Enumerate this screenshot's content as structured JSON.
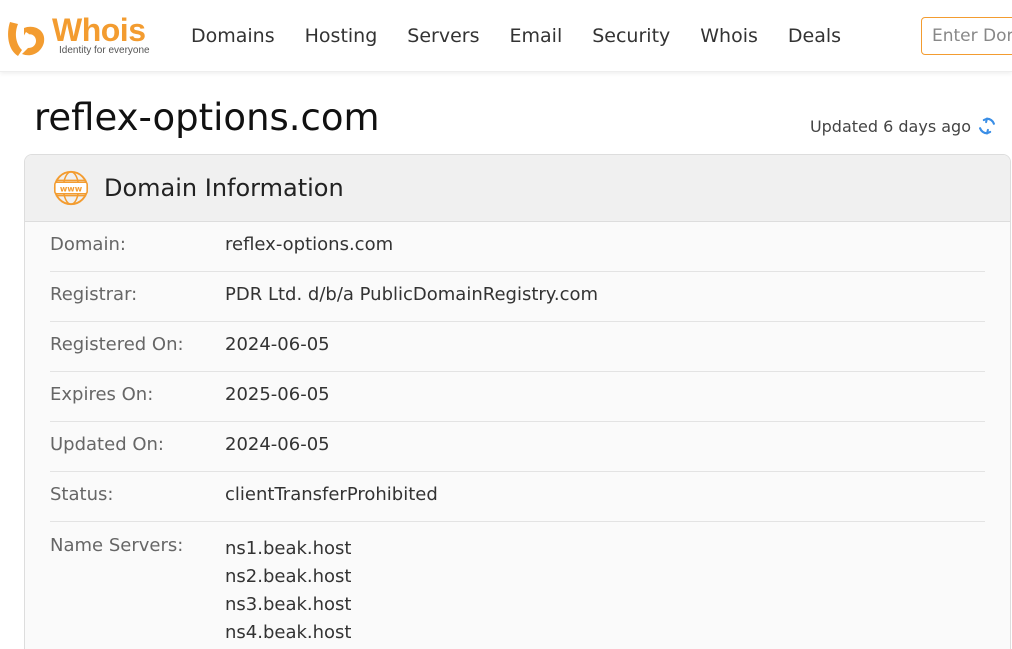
{
  "header": {
    "logo_word": "Whois",
    "logo_tagline": "Identity for everyone",
    "nav": [
      "Domains",
      "Hosting",
      "Servers",
      "Email",
      "Security",
      "Whois",
      "Deals"
    ],
    "search_placeholder": "Enter Domain"
  },
  "page": {
    "title": "reflex-options.com",
    "updated_text": "Updated 6 days ago"
  },
  "card": {
    "title": "Domain Information",
    "rows": [
      {
        "label": "Domain:",
        "value": "reflex-options.com"
      },
      {
        "label": "Registrar:",
        "value": "PDR Ltd. d/b/a PublicDomainRegistry.com"
      },
      {
        "label": "Registered On:",
        "value": "2024-06-05"
      },
      {
        "label": "Expires On:",
        "value": "2025-06-05"
      },
      {
        "label": "Updated On:",
        "value": "2024-06-05"
      },
      {
        "label": "Status:",
        "value": "clientTransferProhibited"
      }
    ],
    "name_servers_label": "Name Servers:",
    "name_servers": [
      "ns1.beak.host",
      "ns2.beak.host",
      "ns3.beak.host",
      "ns4.beak.host"
    ]
  },
  "icons": {
    "logo": "whois-logo-icon",
    "refresh": "refresh-icon",
    "www": "www-globe-icon"
  },
  "colors": {
    "brand": "#f39c30",
    "refresh": "#3a8ee6"
  }
}
